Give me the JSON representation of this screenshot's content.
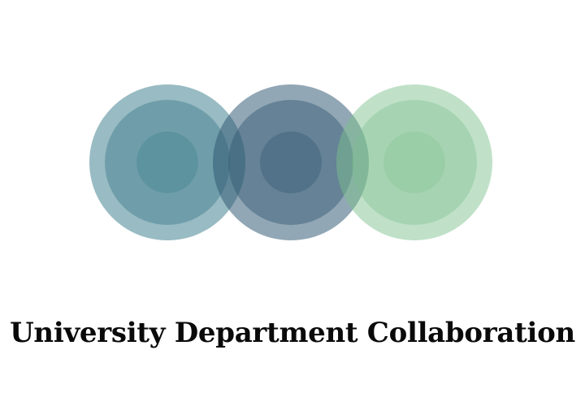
{
  "brand": {
    "name": "University Department Collaboration"
  },
  "logo": {
    "icon": "three-overlapping-concentric-circles-icon",
    "colors": {
      "teal": "#3c7d8c",
      "slate": "#2e5672",
      "green": "#7cc08d"
    }
  }
}
